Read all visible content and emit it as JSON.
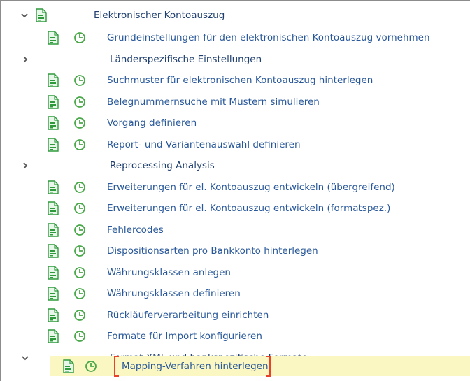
{
  "tree": {
    "root": {
      "label": "Elektronischer Kontoauszug"
    },
    "items": [
      {
        "label": "Grundeinstellungen für den elektronischen Kontoauszug vornehmen",
        "type": "activity"
      },
      {
        "label": "Länderspezifische Einstellungen",
        "type": "folder"
      },
      {
        "label": "Suchmuster für elektronischen Kontoauszug hinterlegen",
        "type": "activity"
      },
      {
        "label": "Belegnummernsuche mit Mustern simulieren",
        "type": "activity"
      },
      {
        "label": "Vorgang definieren",
        "type": "activity"
      },
      {
        "label": "Report- und Variantenauswahl definieren",
        "type": "activity"
      },
      {
        "label": "Reprocessing Analysis",
        "type": "folder"
      },
      {
        "label": "Erweiterungen für el. Kontoauszug entwickeln (übergreifend)",
        "type": "activity"
      },
      {
        "label": "Erweiterungen für el. Kontoauszug entwickeln (formatspez.)",
        "type": "activity"
      },
      {
        "label": "Fehlercodes",
        "type": "activity"
      },
      {
        "label": "Dispositionsarten pro Bankkonto hinterlegen",
        "type": "activity"
      },
      {
        "label": "Währungsklassen anlegen",
        "type": "activity"
      },
      {
        "label": "Währungsklassen definieren",
        "type": "activity"
      },
      {
        "label": "Rückläuferverarbeitung einrichten",
        "type": "activity"
      },
      {
        "label": "Formate für Import konfigurieren",
        "type": "activity"
      },
      {
        "label": "Format XML und bankspezifische Formate",
        "type": "folder-open"
      }
    ],
    "selected": {
      "label": "Mapping-Verfahren hinterlegen"
    }
  },
  "colors": {
    "label_blue": "#29589a",
    "doc_green": "#2f9a3c",
    "clock_green": "#4aa84a",
    "highlight": "#fbf7c2",
    "bracket_red": "#e8422d"
  },
  "icons": {
    "expand": "chevron-right-icon",
    "collapse": "chevron-down-icon",
    "document": "document-icon",
    "clock": "clock-icon"
  }
}
